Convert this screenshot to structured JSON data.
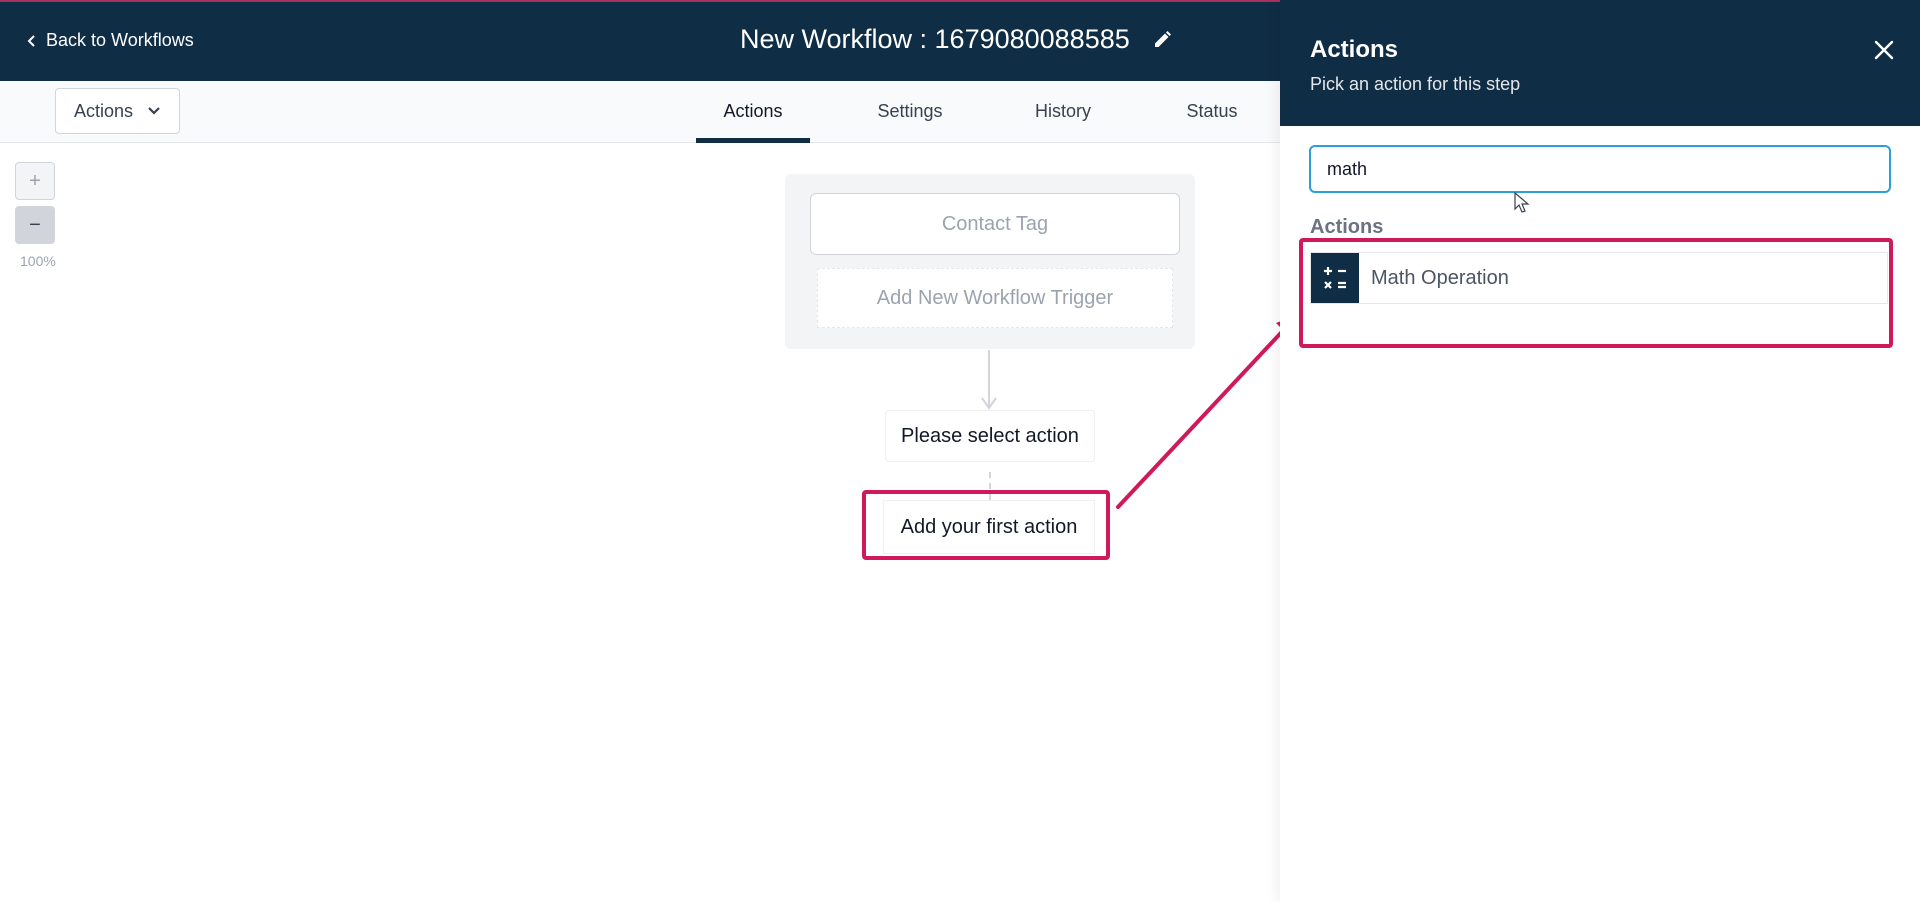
{
  "header": {
    "back_label": "Back to Workflows",
    "workflow_title": "New Workflow : 1679080088585"
  },
  "toolbar": {
    "actions_dropdown_label": "Actions",
    "tabs": [
      {
        "label": "Actions",
        "active": true
      },
      {
        "label": "Settings",
        "active": false
      },
      {
        "label": "History",
        "active": false
      },
      {
        "label": "Status",
        "active": false
      }
    ]
  },
  "canvas": {
    "zoom_in_label": "+",
    "zoom_out_label": "−",
    "zoom_level": "100%",
    "trigger": {
      "contact_tag_label": "Contact Tag",
      "add_trigger_label": "Add New Workflow Trigger"
    },
    "select_action_label": "Please select action",
    "first_action_label": "Add your first action"
  },
  "panel": {
    "title": "Actions",
    "subtitle": "Pick an action for this step",
    "search_value": "math",
    "section_label": "Actions",
    "results": [
      {
        "label": "Math Operation",
        "icon": "calculator-icon"
      }
    ]
  },
  "colors": {
    "header_bg": "#0f2d45",
    "highlight": "#d0195a",
    "input_focus": "#2a9fd8"
  }
}
